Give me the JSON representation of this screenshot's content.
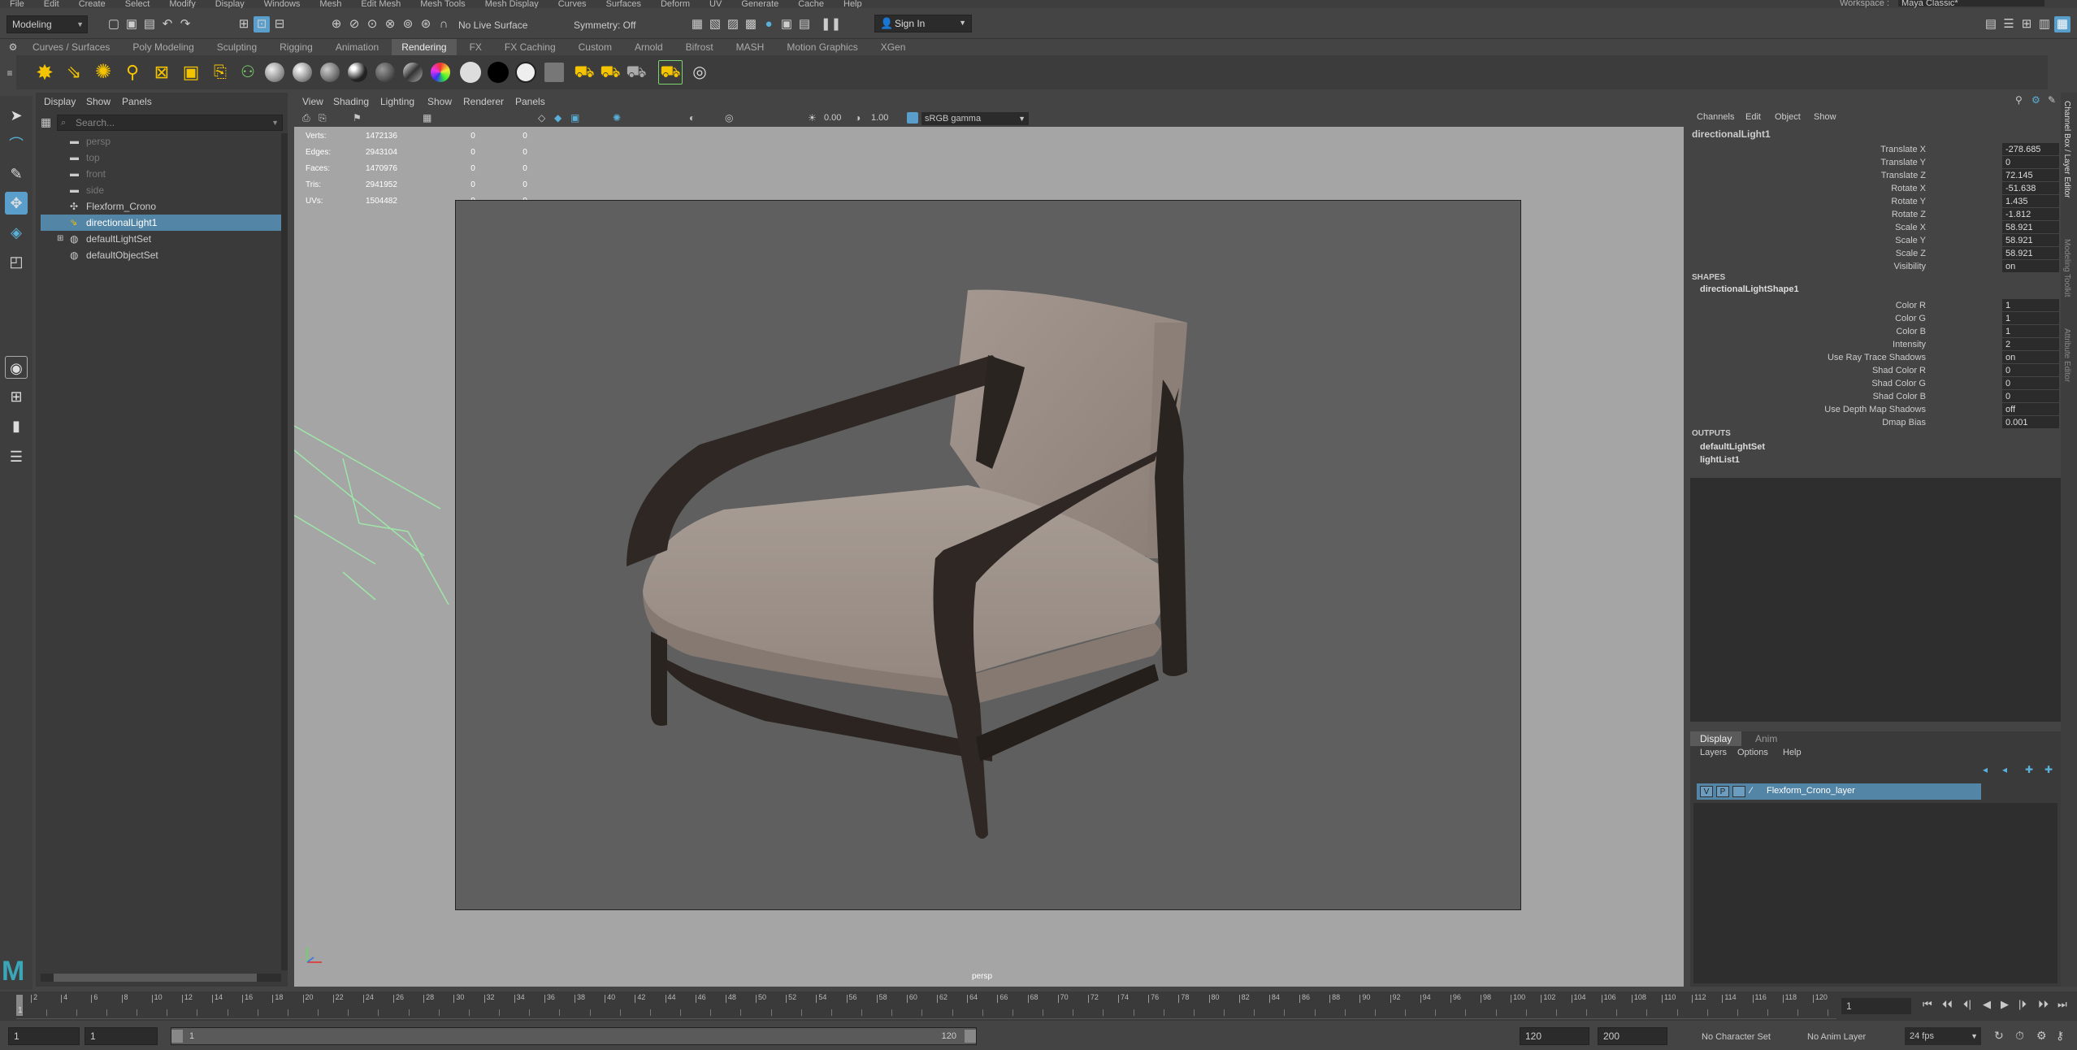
{
  "menubar": {
    "items": [
      "File",
      "Edit",
      "Create",
      "Select",
      "Modify",
      "Display",
      "Windows",
      "Mesh",
      "Edit Mesh",
      "Mesh Tools",
      "Mesh Display",
      "Curves",
      "Surfaces",
      "Deform",
      "UV",
      "Generate",
      "Cache",
      "Help"
    ],
    "workspace_label": "Workspace :",
    "workspace_value": "Maya Classic*"
  },
  "statusline": {
    "mode": "Modeling",
    "live_surface": "No Live Surface",
    "symmetry": "Symmetry: Off",
    "sign_in": "Sign In"
  },
  "shelf": {
    "tabs": [
      "Curves / Surfaces",
      "Poly Modeling",
      "Sculpting",
      "Rigging",
      "Animation",
      "Rendering",
      "FX",
      "FX Caching",
      "Custom",
      "Arnold",
      "Bifrost",
      "MASH",
      "Motion Graphics",
      "XGen"
    ],
    "active_tab": "Rendering"
  },
  "outliner": {
    "menu": [
      "Display",
      "Show",
      "Panels"
    ],
    "search_placeholder": "Search...",
    "items": [
      {
        "label": "persp",
        "dim": true
      },
      {
        "label": "top",
        "dim": true
      },
      {
        "label": "front",
        "dim": true
      },
      {
        "label": "side",
        "dim": true
      },
      {
        "label": "Flexform_Crono",
        "dim": false
      },
      {
        "label": "directionalLight1",
        "dim": false,
        "selected": true
      },
      {
        "label": "defaultLightSet",
        "dim": false
      },
      {
        "label": "defaultObjectSet",
        "dim": false
      }
    ]
  },
  "viewport": {
    "menu": [
      "View",
      "Shading",
      "Lighting",
      "Show",
      "Renderer",
      "Panels"
    ],
    "exposure": "0.00",
    "gamma": "1.00",
    "colorspace": "sRGB gamma",
    "camera_label": "persp",
    "hud": [
      {
        "label": "Verts:",
        "value": "1472136",
        "a": "0",
        "b": "0"
      },
      {
        "label": "Edges:",
        "value": "2943104",
        "a": "0",
        "b": "0"
      },
      {
        "label": "Faces:",
        "value": "1470976",
        "a": "0",
        "b": "0"
      },
      {
        "label": "Tris:",
        "value": "2941952",
        "a": "0",
        "b": "0"
      },
      {
        "label": "UVs:",
        "value": "1504482",
        "a": "0",
        "b": "0"
      }
    ]
  },
  "channelbox": {
    "menu": [
      "Channels",
      "Edit",
      "Object",
      "Show"
    ],
    "object": "directionalLight1",
    "channels": [
      {
        "label": "Translate X",
        "value": "-278.685"
      },
      {
        "label": "Translate Y",
        "value": "0"
      },
      {
        "label": "Translate Z",
        "value": "72.145"
      },
      {
        "label": "Rotate X",
        "value": "-51.638"
      },
      {
        "label": "Rotate Y",
        "value": "1.435"
      },
      {
        "label": "Rotate Z",
        "value": "-1.812"
      },
      {
        "label": "Scale X",
        "value": "58.921"
      },
      {
        "label": "Scale Y",
        "value": "58.921"
      },
      {
        "label": "Scale Z",
        "value": "58.921"
      },
      {
        "label": "Visibility",
        "value": "on"
      }
    ],
    "shapes_header": "SHAPES",
    "shape_name": "directionalLightShape1",
    "shape_channels": [
      {
        "label": "Color R",
        "value": "1"
      },
      {
        "label": "Color G",
        "value": "1"
      },
      {
        "label": "Color B",
        "value": "1"
      },
      {
        "label": "Intensity",
        "value": "2"
      },
      {
        "label": "Use Ray Trace Shadows",
        "value": "on"
      },
      {
        "label": "Shad Color R",
        "value": "0"
      },
      {
        "label": "Shad Color G",
        "value": "0"
      },
      {
        "label": "Shad Color B",
        "value": "0"
      },
      {
        "label": "Use Depth Map Shadows",
        "value": "off"
      },
      {
        "label": "Dmap Bias",
        "value": "0.001"
      }
    ],
    "outputs_header": "OUTPUTS",
    "outputs": [
      "defaultLightSet",
      "lightList1"
    ]
  },
  "layers": {
    "tabs": [
      "Display",
      "Anim"
    ],
    "menu": [
      "Layers",
      "Options",
      "Help"
    ],
    "layer": {
      "v": "V",
      "p": "P",
      "name": "Flexform_Crono_layer"
    }
  },
  "rightstrip": {
    "labels": [
      "Channel Box / Layer Editor",
      "Modeling Toolkit",
      "Attribute Editor"
    ]
  },
  "timeline": {
    "ticks": [
      "2",
      "4",
      "6",
      "8",
      "10",
      "12",
      "14",
      "16",
      "18",
      "20",
      "22",
      "24",
      "26",
      "28",
      "30",
      "32",
      "34",
      "36",
      "38",
      "40",
      "42",
      "44",
      "46",
      "48",
      "50",
      "52",
      "54",
      "56",
      "58",
      "60",
      "62",
      "64",
      "66",
      "68",
      "70",
      "72",
      "74",
      "76",
      "78",
      "80",
      "82",
      "84",
      "86",
      "88",
      "90",
      "92",
      "94",
      "96",
      "98",
      "100",
      "102",
      "104",
      "106",
      "108",
      "110",
      "112",
      "114",
      "116",
      "118",
      "120"
    ],
    "start_mark": "1",
    "current_frame": "1"
  },
  "range": {
    "start": "1",
    "anim_start": "1",
    "slider_start": "1",
    "slider_end": "120",
    "end": "120",
    "anim_end": "200",
    "character_set": "No Character Set",
    "anim_layer": "No Anim Layer",
    "fps": "24 fps"
  },
  "colors": {
    "selection": "#5285a6",
    "accent": "#5a9fcc"
  }
}
